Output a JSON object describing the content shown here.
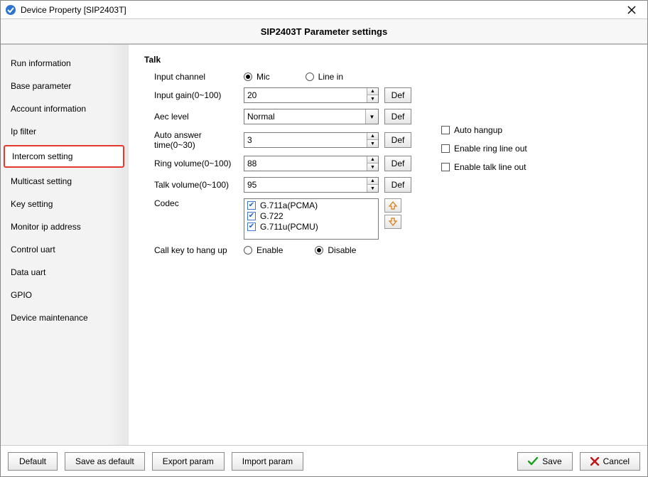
{
  "window": {
    "title": "Device Property [SIP2403T]",
    "header": "SIP2403T Parameter settings"
  },
  "sidebar": {
    "items": [
      {
        "label": "Run information"
      },
      {
        "label": "Base parameter"
      },
      {
        "label": "Account information"
      },
      {
        "label": "Ip filter"
      },
      {
        "label": "Intercom setting",
        "highlighted": true
      },
      {
        "label": "Multicast setting"
      },
      {
        "label": "Key setting"
      },
      {
        "label": "Monitor ip address"
      },
      {
        "label": "Control uart"
      },
      {
        "label": "Data uart"
      },
      {
        "label": "GPIO"
      },
      {
        "label": "Device maintenance"
      }
    ]
  },
  "talk": {
    "section_title": "Talk",
    "labels": {
      "input_channel": "Input channel",
      "input_gain": "Input gain(0~100)",
      "aec_level": "Aec level",
      "auto_answer": "Auto answer time(0~30)",
      "ring_volume": "Ring volume(0~100)",
      "talk_volume": "Talk volume(0~100)",
      "codec": "Codec",
      "call_key_hangup": "Call key to hang up"
    },
    "def_label": "Def",
    "input_channel": {
      "mic": "Mic",
      "linein": "Line in",
      "selected": "mic"
    },
    "input_gain": "20",
    "aec_level": "Normal",
    "auto_answer": "3",
    "ring_volume": "88",
    "talk_volume": "95",
    "codec": {
      "opts": [
        {
          "label": "G.711a(PCMA)",
          "checked": true
        },
        {
          "label": "G.722",
          "checked": true
        },
        {
          "label": "G.711u(PCMU)",
          "checked": true
        }
      ]
    },
    "call_key_hangup": {
      "enable": "Enable",
      "disable": "Disable",
      "selected": "disable"
    },
    "side": {
      "auto_hangup": "Auto hangup",
      "enable_ring_line_out": "Enable ring line out",
      "enable_talk_line_out": "Enable talk line out"
    }
  },
  "footer": {
    "default": "Default",
    "save_as_default": "Save as default",
    "export_param": "Export param",
    "import_param": "Import param",
    "save": "Save",
    "cancel": "Cancel"
  }
}
